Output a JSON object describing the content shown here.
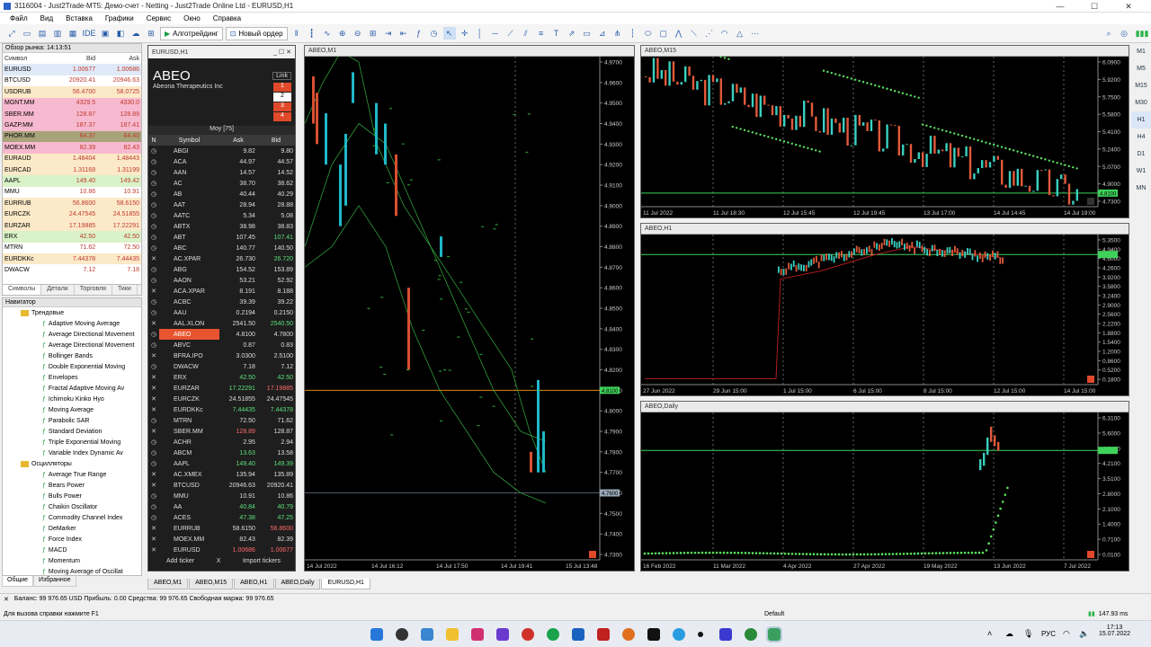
{
  "window": {
    "title": "3116004 - Just2Trade-MT5: Демо-счет - Netting - Just2Trade Online Ltd - EURUSD,H1"
  },
  "menu": [
    "Файл",
    "Вид",
    "Вставка",
    "Графики",
    "Сервис",
    "Окно",
    "Справка"
  ],
  "toolbar": {
    "ide": "IDE",
    "algo": "Алготрейдинг",
    "neworder": "Новый ордер"
  },
  "market_watch": {
    "title": "Обзор рынка: 14:13:51",
    "headers": [
      "Символ",
      "Bid",
      "Ask"
    ],
    "rows": [
      [
        "EURUSD",
        "1.00677",
        "1.00686",
        "#dfe9f7"
      ],
      [
        "BTCUSD",
        "20920.41",
        "20946.63",
        "#ffffff"
      ],
      [
        "USDRUB",
        "56.4700",
        "58.0725",
        "#fbe9c8"
      ],
      [
        "MGNT.MM",
        "4329.5",
        "4330.0",
        "#f7b9cf"
      ],
      [
        "SBER.MM",
        "128.87",
        "128.89",
        "#f7b9cf"
      ],
      [
        "GAZP.MM",
        "187.37",
        "187.41",
        "#f7b9cf"
      ],
      [
        "PHOR.MM",
        "64.37",
        "64.40",
        "#a7a37a"
      ],
      [
        "MOEX.MM",
        "82.39",
        "82.43",
        "#f7b9cf"
      ],
      [
        "EURAUD",
        "1.48404",
        "1.48443",
        "#fbe9c8"
      ],
      [
        "EURCAD",
        "1.31168",
        "1.31199",
        "#fbe9c8"
      ],
      [
        "AAPL",
        "149.40",
        "149.42",
        "#d9f2c8"
      ],
      [
        "MMU",
        "10.86",
        "10.91",
        "#ffffff"
      ],
      [
        "EURRUB",
        "56.8600",
        "58.6150",
        "#fbe9c8"
      ],
      [
        "EURCZK",
        "24.47545",
        "24.51855",
        "#fbe9c8"
      ],
      [
        "EURZAR",
        "17.19885",
        "17.22291",
        "#fbe9c8"
      ],
      [
        "ERX",
        "42.50",
        "42.50",
        "#d9f2c8"
      ],
      [
        "MTRN",
        "71.62",
        "72.50",
        "#ffffff"
      ],
      [
        "EURDKKc",
        "7.44378",
        "7.44435",
        "#fbe9c8"
      ],
      [
        "DWACW",
        "7.12",
        "7.18",
        "#ffffff"
      ]
    ],
    "tabs": [
      "Символы",
      "Детали",
      "Торговля",
      "Тики"
    ]
  },
  "navigator": {
    "title": "Навигатор",
    "groups": [
      {
        "name": "Трендовые",
        "items": [
          "Adaptive Moving Average",
          "Average Directional Movement",
          "Average Directional Movement",
          "Bollinger Bands",
          "Double Exponential Moving",
          "Envelopes",
          "Fractal Adaptive Moving Av",
          "Ichimoku Kinko Hyo",
          "Moving Average",
          "Parabolic SAR",
          "Standard Deviation",
          "Triple Exponential Moving",
          "Variable Index Dynamic Av"
        ]
      },
      {
        "name": "Осцилляторы",
        "items": [
          "Average True Range",
          "Bears Power",
          "Bulls Power",
          "Chaikin Oscillator",
          "Commodity Channel Index",
          "DeMarker",
          "Force Index",
          "MACD",
          "Momentum",
          "Moving Average of Oscillat"
        ]
      }
    ],
    "tabs": [
      "Общие",
      "Избранное"
    ]
  },
  "watchlist": {
    "title": "EURUSD,H1",
    "ticker": "ABEO",
    "company": "Abeona Therapeutics Inc",
    "link": "Link",
    "links": [
      "1",
      "2",
      "3",
      "4"
    ],
    "list_name": "Моу [75]",
    "cols": [
      "N",
      "Symbol",
      "Ask",
      "Bid"
    ],
    "rows": [
      [
        "ABGI",
        "9.82",
        "9.80",
        "",
        "",
        "c"
      ],
      [
        "ACA",
        "44.97",
        "44.57",
        "",
        "",
        "c"
      ],
      [
        "AAN",
        "14.57",
        "14.52",
        "",
        "",
        "c"
      ],
      [
        "AC",
        "38.70",
        "38.62",
        "",
        "",
        "c"
      ],
      [
        "AB",
        "40.44",
        "40.29",
        "",
        "",
        "c"
      ],
      [
        "AAT",
        "28.94",
        "28.88",
        "",
        "",
        "c"
      ],
      [
        "AATC",
        "5.34",
        "5.08",
        "",
        "",
        "c"
      ],
      [
        "ABTX",
        "38.98",
        "38.83",
        "",
        "",
        "c"
      ],
      [
        "ABT",
        "107.45",
        "107.41",
        "",
        "#5de07a",
        "c"
      ],
      [
        "ABC",
        "140.77",
        "140.50",
        "",
        "",
        "c"
      ],
      [
        "AC.XPAR",
        "26.730",
        "26.720",
        "",
        "#5de07a",
        "x"
      ],
      [
        "ABG",
        "154.52",
        "153.89",
        "",
        "",
        "c"
      ],
      [
        "AAON",
        "53.21",
        "52.92",
        "",
        "",
        "c"
      ],
      [
        "ACA.XPAR",
        "8.191",
        "8.188",
        "",
        "",
        "x"
      ],
      [
        "ACBC",
        "39.39",
        "39.22",
        "",
        "",
        "c"
      ],
      [
        "AAU",
        "0.2194",
        "0.2150",
        "",
        "",
        "c"
      ],
      [
        "AAL.XLON",
        "2541.50",
        "2540.50",
        "",
        "#5de07a",
        "x"
      ],
      [
        "ABEO",
        "4.8100",
        "4.7800",
        "",
        "",
        "c"
      ],
      [
        "ABVC",
        "0.87",
        "0.83",
        "",
        "",
        "c"
      ],
      [
        "BFRA.IPO",
        "3.0300",
        "2.5100",
        "",
        "",
        "x"
      ],
      [
        "DWACW",
        "7.18",
        "7.12",
        "",
        "",
        "c"
      ],
      [
        "ERX",
        "42.50",
        "42.50",
        "#5de07a",
        "#5de07a",
        "x"
      ],
      [
        "EURZAR",
        "17.22291",
        "17.19885",
        "#5de07a",
        "#ff6a6a",
        "x"
      ],
      [
        "EURCZK",
        "24.51855",
        "24.47545",
        "",
        "",
        "x"
      ],
      [
        "EURDKKc",
        "7.44435",
        "7.44378",
        "#5de07a",
        "#5de07a",
        "x"
      ],
      [
        "MTRN",
        "72.50",
        "71.62",
        "",
        "",
        "c"
      ],
      [
        "SBER.MM",
        "128.89",
        "128.87",
        "#ff6a6a",
        "",
        "x"
      ],
      [
        "ACHR",
        "2.95",
        "2.94",
        "",
        "",
        "c"
      ],
      [
        "ABCM",
        "13.63",
        "13.58",
        "#5de07a",
        "",
        "c"
      ],
      [
        "AAPL",
        "149.40",
        "149.39",
        "#5de07a",
        "#5de07a",
        "c"
      ],
      [
        "AC.XMEX",
        "135.94",
        "135.89",
        "",
        "",
        "x"
      ],
      [
        "BTCUSD",
        "20946.63",
        "20920.41",
        "",
        "",
        "x"
      ],
      [
        "MMU",
        "10.91",
        "10.86",
        "",
        "",
        "c"
      ],
      [
        "AA",
        "40.84",
        "40.79",
        "#5de07a",
        "#5de07a",
        "c"
      ],
      [
        "ACES",
        "47.38",
        "47.25",
        "#5de07a",
        "#5de07a",
        "c"
      ],
      [
        "EURRUB",
        "58.6150",
        "56.8600",
        "",
        "#ff6a6a",
        "x"
      ],
      [
        "MOEX.MM",
        "82.43",
        "82.39",
        "",
        "",
        "x"
      ],
      [
        "EURUSD",
        "1.00686",
        "1.00677",
        "#ff6a6a",
        "#ff6a6a",
        "x"
      ]
    ],
    "add": "Add ticker",
    "x": "X",
    "import": "Import tickers"
  },
  "charts": {
    "main": {
      "title": "ABEO,M1",
      "prices": [
        "4.9700",
        "4.9600",
        "4.9500",
        "4.9400",
        "4.9300",
        "4.9200",
        "4.9100",
        "4.9000",
        "4.8900",
        "4.8800",
        "4.8700",
        "4.8600",
        "4.8500",
        "4.8400",
        "4.8300",
        "4.8200",
        "4.8100",
        "4.8000",
        "4.7900",
        "4.7800",
        "4.7700",
        "4.7600",
        "4.7500",
        "4.7400",
        "4.7300"
      ],
      "times": [
        "14 Jul 2022",
        "14 Jul 16:12",
        "14 Jul 17:50",
        "14 Jul 19:41",
        "15 Jul 13:48"
      ],
      "bid_label": "4.8100",
      "ask_label": "4.7600"
    },
    "m15": {
      "title": "ABEO,M15",
      "prices": [
        "6.0900",
        "5.9200",
        "5.7500",
        "5.5800",
        "5.4100",
        "5.2400",
        "5.0700",
        "4.9000",
        "4.7300"
      ],
      "times": [
        "11 Jul 2022",
        "11 Jul 18:30",
        "12 Jul 15:45",
        "12 Jul 19:45",
        "13 Jul 17:00",
        "14 Jul 14:45",
        "14 Jul 19:00"
      ],
      "price_label": "4.8100"
    },
    "h1": {
      "title": "ABEO,H1",
      "prices": [
        "5.3500",
        "4.9400",
        "4.6000",
        "4.2600",
        "3.9200",
        "3.5800",
        "3.2400",
        "2.9000",
        "2.5600",
        "2.2200",
        "1.8800",
        "1.5400",
        "1.2000",
        "0.8600",
        "0.5200",
        "0.1800"
      ],
      "times": [
        "27 Jun 2022",
        "29 Jun 15:00",
        "1 Jul 15:00",
        "6 Jul 15:00",
        "8 Jul 15:00",
        "12 Jul 15:00",
        "14 Jul 15:00"
      ]
    },
    "daily": {
      "title": "ABEO,Daily",
      "prices": [
        "6.3100",
        "5.6000",
        "4.9000",
        "4.2100",
        "3.5100",
        "2.8000",
        "2.1000",
        "1.4000",
        "0.7100",
        "0.0100"
      ],
      "times": [
        "16 Feb 2022",
        "11 Mar 2022",
        "4 Apr 2022",
        "27 Apr 2022",
        "19 May 2022",
        "13 Jun 2022",
        "7 Jul 2022"
      ]
    }
  },
  "chart_tabs": [
    "ABEO,M1",
    "ABEO,M15",
    "ABEO,H1",
    "ABEO,Daily",
    "EURUSD,H1"
  ],
  "timeframes": [
    "M1",
    "M5",
    "M15",
    "M30",
    "H1",
    "H4",
    "D1",
    "W1",
    "MN"
  ],
  "status": {
    "balance": "Баланс: 99 976.65 USD  Прибыль: 0.00  Средства: 99 976.65  Свободная маржа: 99 976.65",
    "help": "Для вызова справки нажмите F1",
    "profile": "Default",
    "net": "147.93 ms"
  },
  "taskbar": {
    "lang": "РУС",
    "time": "17:13",
    "date": "15.07.2022"
  }
}
